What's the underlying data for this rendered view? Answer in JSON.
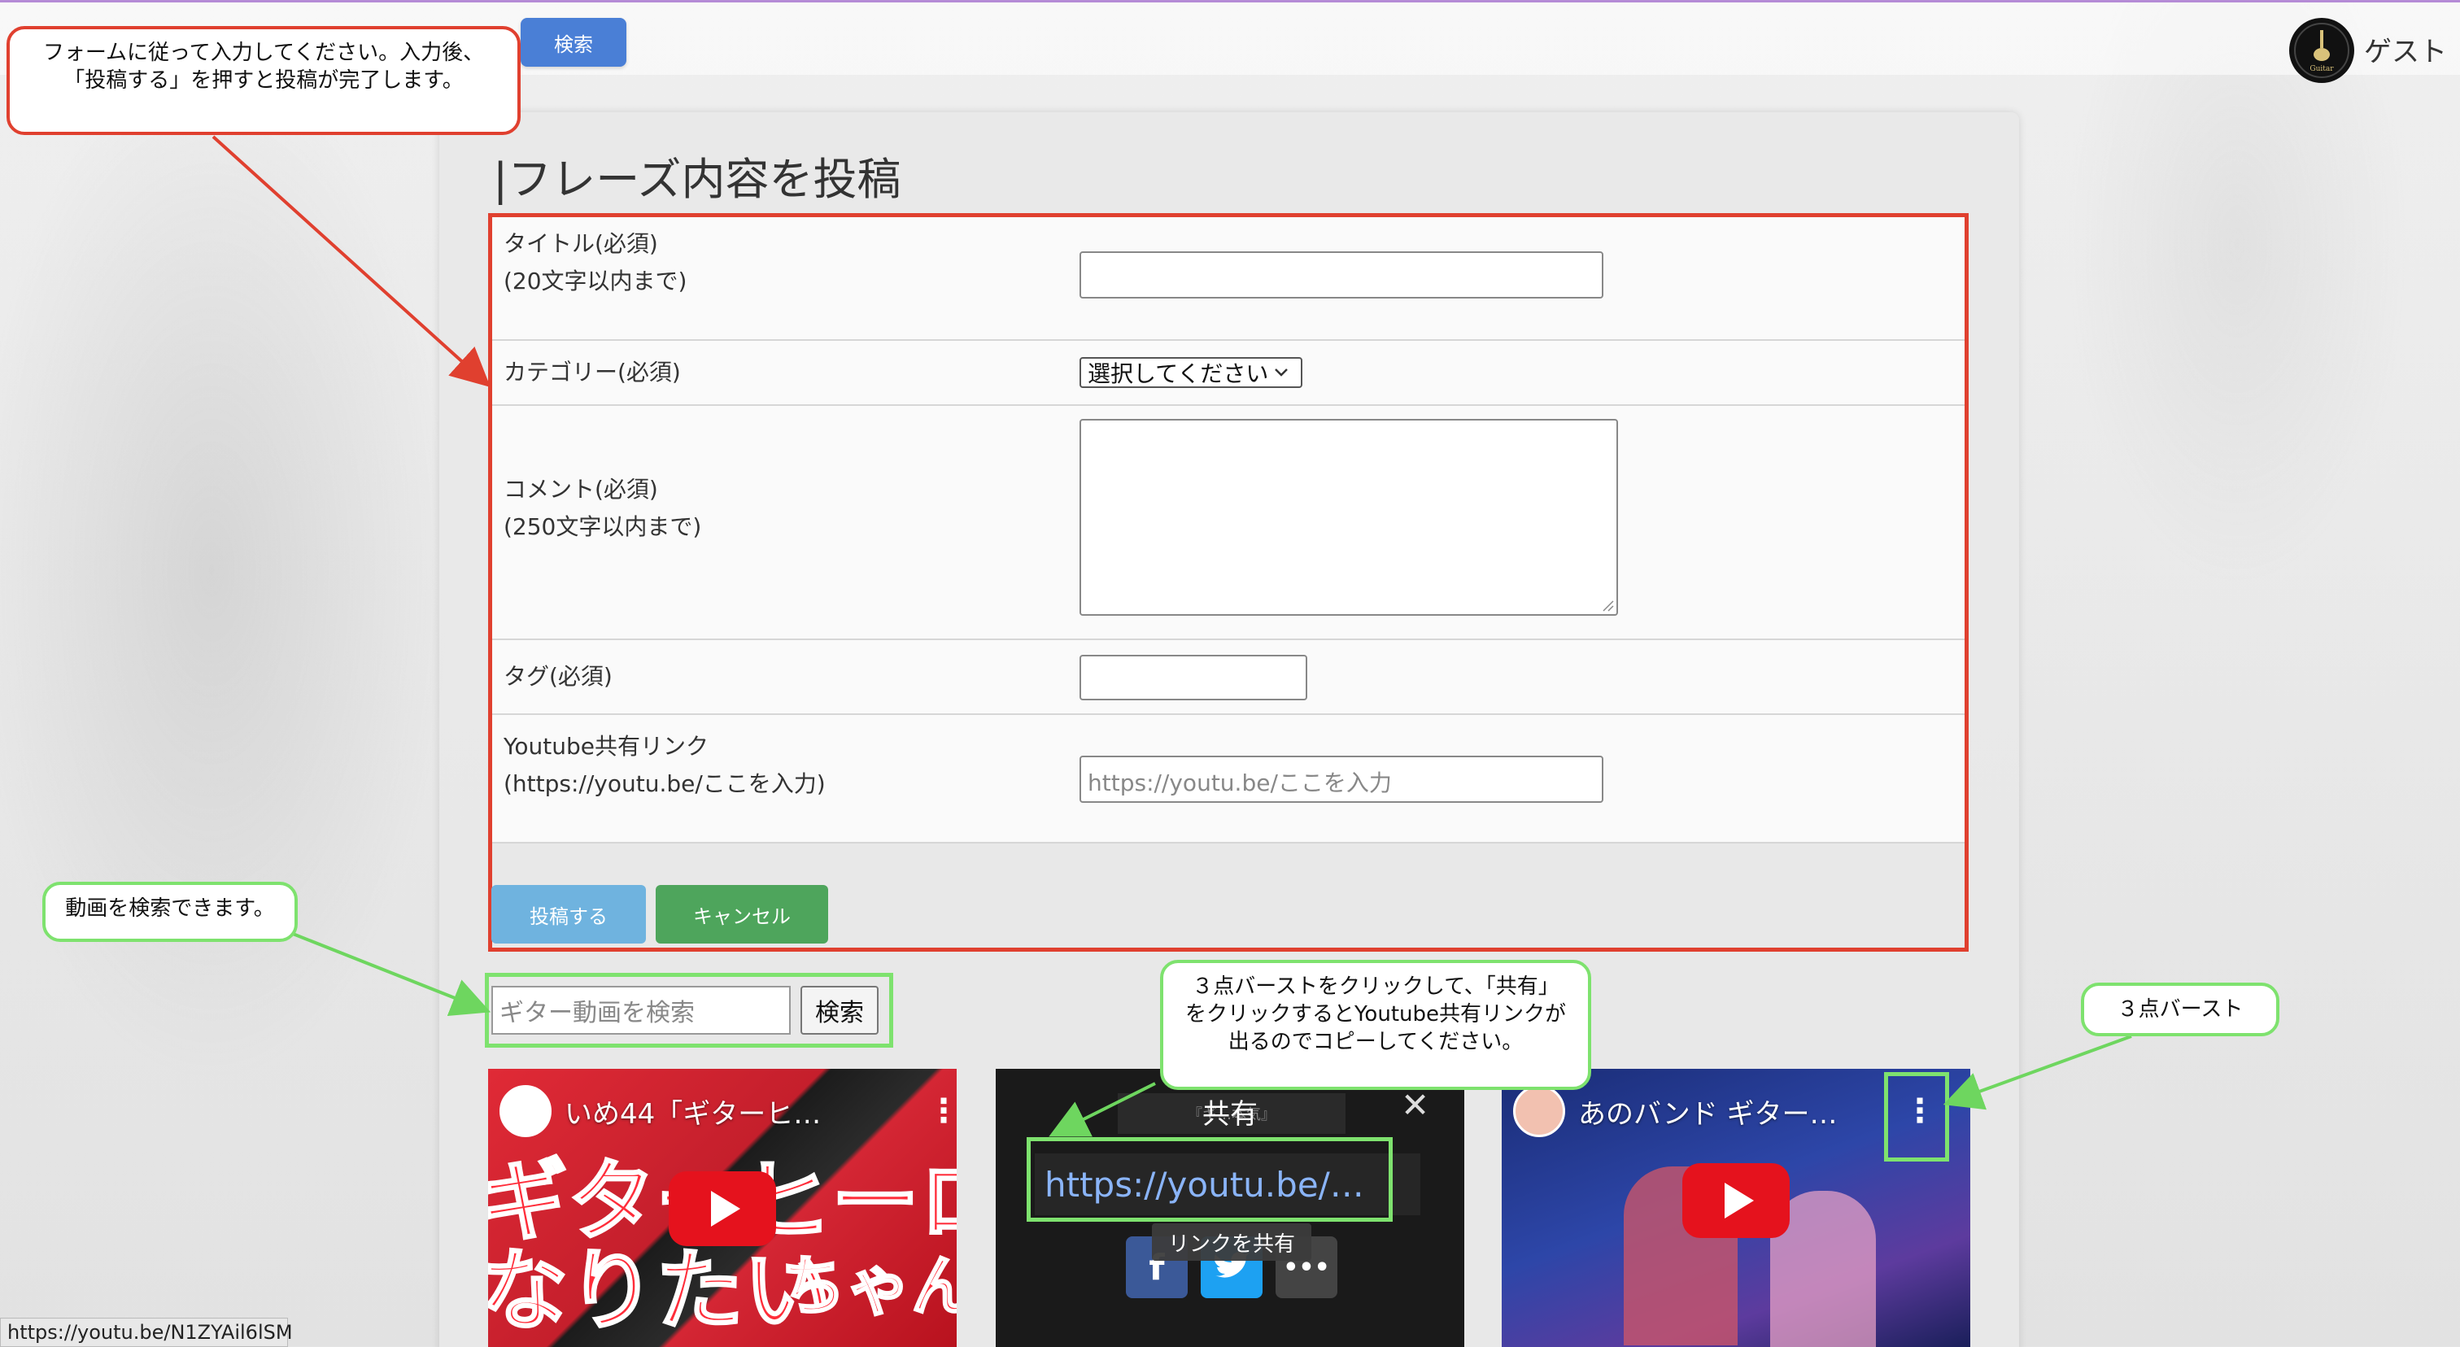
{
  "header": {
    "search_button": "検索",
    "user_name": "ゲスト",
    "logo_text": "Guitar"
  },
  "form": {
    "heading": "|フレーズ内容を投稿",
    "title_label_line1": "タイトル(必須)",
    "title_label_line2": "(20文字以内まで)",
    "category_label": "カテゴリー(必須)",
    "category_selected": "選択してください",
    "comment_label_line1": "コメント(必須)",
    "comment_label_line2": "(250文字以内まで)",
    "tag_label": "タグ(必須)",
    "youtube_label_line1": "Youtube共有リンク",
    "youtube_label_line2": "(https://youtu.be/ここを入力)",
    "youtube_placeholder": "https://youtu.be/ここを入力",
    "submit_button": "投稿する",
    "cancel_button": "キャンセル"
  },
  "video_search": {
    "placeholder": "ギター動画を検索",
    "button": "検索"
  },
  "videos": [
    {
      "title": "いめ44「ギターヒ…",
      "overlay_text_1": "ギターヒーロ",
      "overlay_text_2": "なりたい",
      "overlay_text_3": "ちゃん"
    },
    {
      "share_title": "共有",
      "share_url": "https://youtu.be/…",
      "share_tooltip": "リンクを共有",
      "behind_text": "『ギ…本気』"
    },
    {
      "title": "あのバンド ギター…"
    }
  ],
  "callouts": {
    "form_help_line1": "フォームに従って入力してください。入力後、",
    "form_help_line2": "「投稿する」を押すと投稿が完了します。",
    "search_help": "動画を検索できます。",
    "share_help_line1": "３点バーストをクリックして、「共有」",
    "share_help_line2": "をクリックするとYoutube共有リンクが",
    "share_help_line3": "出るのでコピーしてください。",
    "kebab_help": "３点バースト"
  },
  "status_bar_url": "https://youtu.be/N1ZYAil6lSM",
  "colors": {
    "callout_red": "#e0402f",
    "callout_green": "#7ee26e",
    "submit": "#6fb3df",
    "cancel": "#4ea55c",
    "primary": "#4a7fd6"
  }
}
